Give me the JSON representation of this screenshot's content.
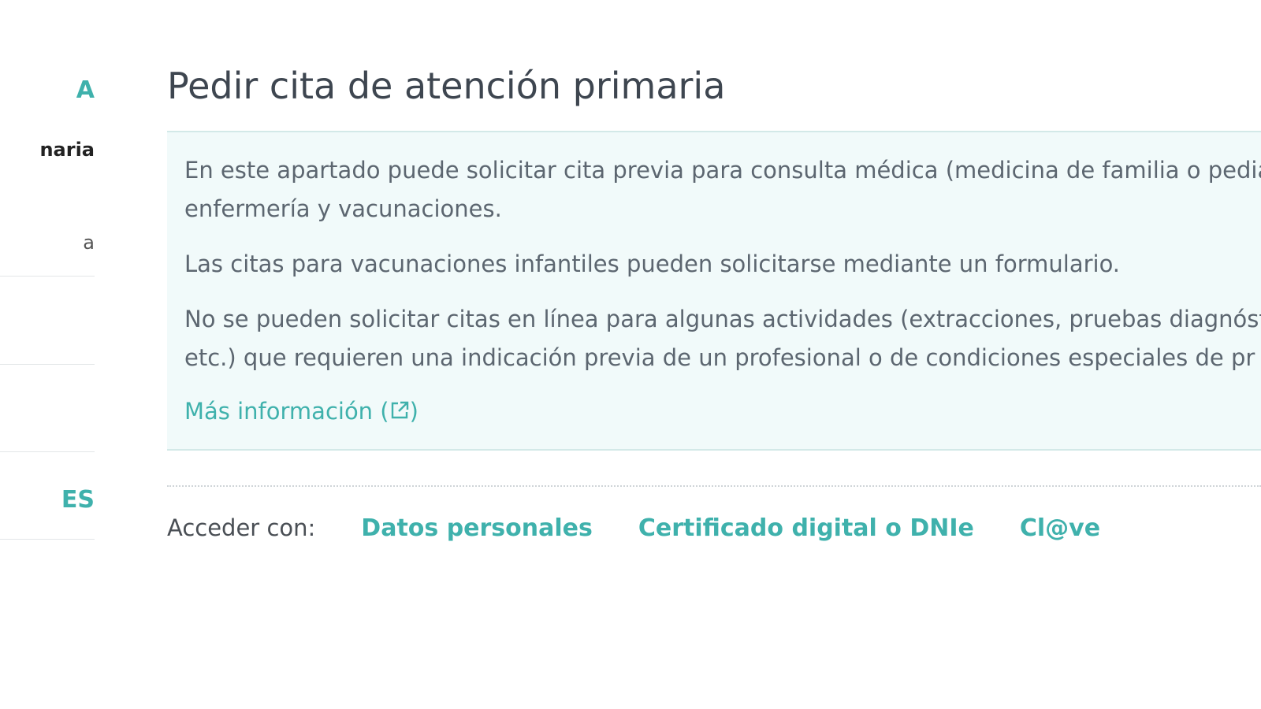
{
  "sidebar": {
    "heading_top": "A",
    "items": [
      {
        "label": "naria",
        "active": true
      },
      {
        "label": "a",
        "active": false
      }
    ],
    "heading_bottom": "ES"
  },
  "main": {
    "title": "Pedir cita de atención primaria",
    "info": {
      "paragraph1_line1": "En este apartado puede solicitar cita previa para consulta médica (medicina de familia o pedia",
      "paragraph1_line2": "enfermería y vacunaciones.",
      "paragraph2": "Las citas para vacunaciones infantiles pueden solicitarse mediante un formulario.",
      "paragraph3_line1": "No se pueden solicitar citas en línea para algunas actividades (extracciones, pruebas diagnóst",
      "paragraph3_line2": "etc.) que requieren una indicación previa de un profesional o de condiciones especiales de pr",
      "more_info_label": "Más información (",
      "more_info_close": ")"
    },
    "access": {
      "label": "Acceder con:",
      "options": [
        "Datos personales",
        "Certificado digital o DNIe",
        "Cl@ve"
      ]
    }
  },
  "colors": {
    "accent": "#3fb1ac",
    "info_bg": "#f1fafa",
    "title": "#3e4650"
  }
}
